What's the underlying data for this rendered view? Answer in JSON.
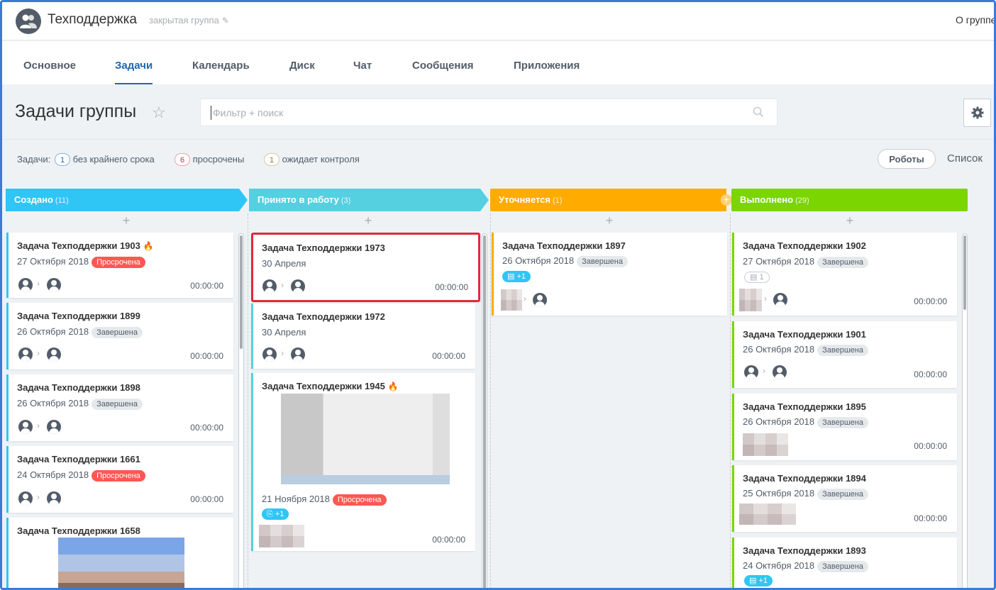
{
  "group": {
    "title": "Техподдержка",
    "type": "закрытая группа",
    "about": "О группе"
  },
  "tabs": [
    "Основное",
    "Задачи",
    "Календарь",
    "Диск",
    "Чат",
    "Сообщения",
    "Приложения"
  ],
  "active_tab": "Задачи",
  "page_title": "Задачи группы",
  "search": {
    "placeholder": "Фильтр + поиск",
    "value": ""
  },
  "counters": {
    "label": "Задачи:",
    "no_deadline": {
      "count": "1",
      "text": "без крайнего срока"
    },
    "overdue": {
      "count": "6",
      "text": "просрочены"
    },
    "awaiting": {
      "count": "1",
      "text": "ожидает контроля"
    }
  },
  "toolbar": {
    "robots": "Роботы",
    "list": "Список"
  },
  "colors": {
    "accent": "#2067b0",
    "created": "#2fc6f6",
    "in_progress": "#55d0e0",
    "clarifying": "#ffab00",
    "done": "#7bd500",
    "overdue": "#ff5752"
  },
  "columns": [
    {
      "title": "Создано",
      "count": "(11)",
      "cards": [
        {
          "title": "Задача Техподдержки 1903",
          "date": "27 Октября 2018",
          "status": "Просрочена",
          "timer": "00:00:00"
        },
        {
          "title": "Задача Техподдержки 1899",
          "date": "26 Октября 2018",
          "status": "Завершена",
          "timer": "00:00:00"
        },
        {
          "title": "Задача Техподдержки 1898",
          "date": "26 Октября 2018",
          "status": "Завершена",
          "timer": "00:00:00"
        },
        {
          "title": "Задача Техподдержки 1661",
          "date": "24 Октября 2018",
          "status": "Просрочена",
          "timer": "00:00:00"
        },
        {
          "title": "Задача Техподдержки 1658"
        }
      ]
    },
    {
      "title": "Принято в работу",
      "count": "(3)",
      "cards": [
        {
          "title": "Задача Техподдержки 1973",
          "date": "30 Апреля",
          "timer": "00:00:00"
        },
        {
          "title": "Задача Техподдержки 1972",
          "date": "30 Апреля",
          "timer": "00:00:00"
        },
        {
          "title": "Задача Техподдержки 1945",
          "date": "21 Ноября 2018",
          "status": "Просрочена",
          "files": "+1",
          "timer": "00:00:00"
        }
      ]
    },
    {
      "title": "Уточняется",
      "count": "(1)",
      "cards": [
        {
          "title": "Задача Техподдержки 1897",
          "date": "26 Октября 2018",
          "status": "Завершена",
          "comments": "+1"
        }
      ]
    },
    {
      "title": "Выполнено",
      "count": "(29)",
      "cards": [
        {
          "title": "Задача Техподдержки 1902",
          "date": "27 Октября 2018",
          "status": "Завершена",
          "comments": "1",
          "timer": "00:00:00"
        },
        {
          "title": "Задача Техподдержки 1901",
          "date": "26 Октября 2018",
          "status": "Завершена",
          "timer": "00:00:00"
        },
        {
          "title": "Задача Техподдержки 1895",
          "date": "26 Октября 2018",
          "status": "Завершена",
          "timer": "00:00:00"
        },
        {
          "title": "Задача Техподдержки 1894",
          "date": "25 Октября 2018",
          "status": "Завершена",
          "timer": "00:00:00"
        },
        {
          "title": "Задача Техподдержки 1893",
          "date": "24 Октября 2018",
          "status": "Завершена",
          "comments": "+1"
        }
      ]
    }
  ]
}
